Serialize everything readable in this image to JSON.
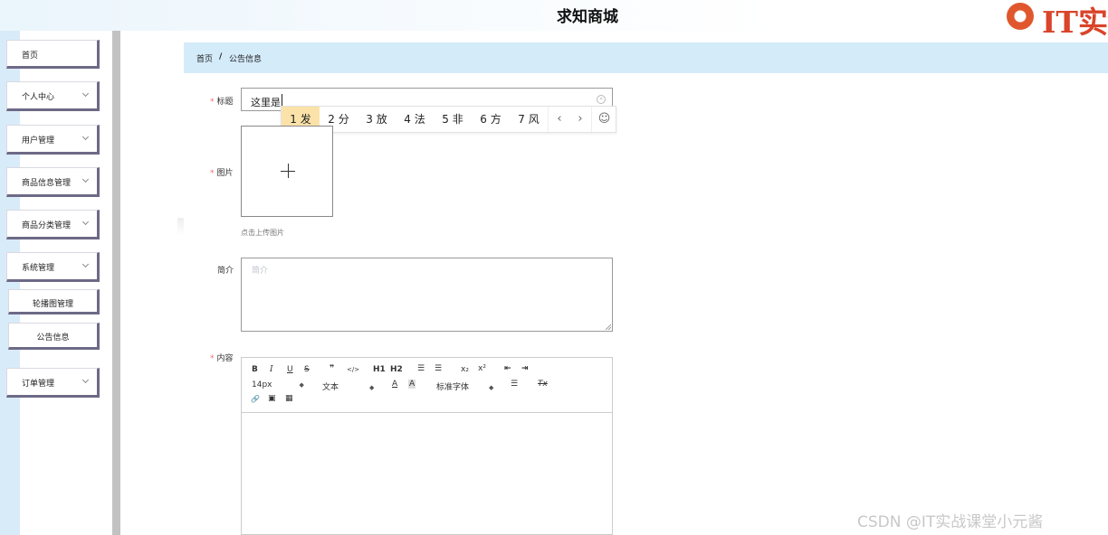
{
  "app": {
    "title": "求知商城",
    "logo_text": "IT实"
  },
  "sidebar": {
    "items": [
      {
        "label": "首页",
        "has_chevron": false
      },
      {
        "label": "个人中心",
        "has_chevron": true
      },
      {
        "label": "用户管理",
        "has_chevron": true
      },
      {
        "label": "商品信息管理",
        "has_chevron": true
      },
      {
        "label": "商品分类管理",
        "has_chevron": true
      },
      {
        "label": "系统管理",
        "has_chevron": true
      },
      {
        "label": "轮播图管理",
        "has_chevron": false
      },
      {
        "label": "公告信息",
        "has_chevron": false
      },
      {
        "label": "订单管理",
        "has_chevron": true
      }
    ]
  },
  "breadcrumb": {
    "home": "首页",
    "separator": "/",
    "current": "公告信息"
  },
  "form": {
    "title_label": "标题",
    "title_value": "这里是",
    "image_label": "图片",
    "upload_hint": "点击上传图片",
    "intro_label": "简介",
    "intro_placeholder": "简介",
    "content_label": "内容",
    "required_mark": "*"
  },
  "ime": {
    "candidates": [
      {
        "num": "1",
        "char": "发"
      },
      {
        "num": "2",
        "char": "分"
      },
      {
        "num": "3",
        "char": "放"
      },
      {
        "num": "4",
        "char": "法"
      },
      {
        "num": "5",
        "char": "非"
      },
      {
        "num": "6",
        "char": "方"
      },
      {
        "num": "7",
        "char": "风"
      }
    ],
    "prev": "‹",
    "next": "›",
    "emoji": "☺"
  },
  "editor_toolbar": {
    "bold": "B",
    "italic": "I",
    "underline": "U",
    "strike": "S",
    "blockquote": "❞",
    "code": "</>",
    "h1": "H1",
    "h2": "H2",
    "ordered_list": "☰",
    "bullet_list": "☰",
    "subscript": "x₂",
    "superscript": "x²",
    "outdent": "⇤",
    "indent": "⇥",
    "font_size": "14px",
    "paragraph": "文本",
    "font_color": "A",
    "bg_color": "A",
    "font_family": "标准字体",
    "align": "☰",
    "clean": "Tx",
    "link": "🔗",
    "image": "▣",
    "video": "▦"
  },
  "watermark": "CSDN @IT实战课堂小元酱"
}
